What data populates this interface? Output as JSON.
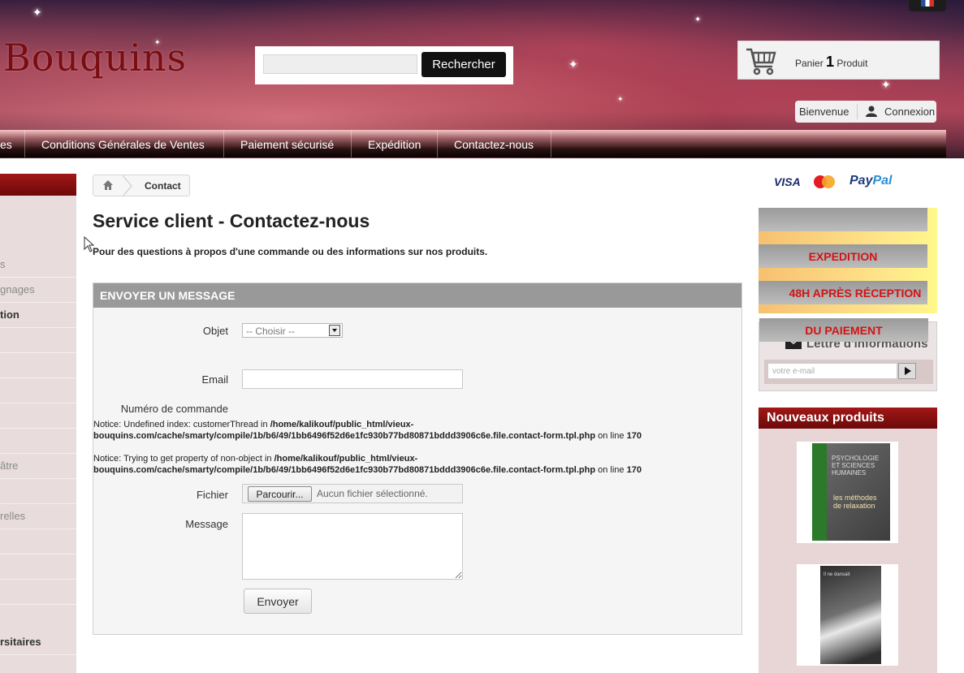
{
  "header": {
    "logo_text": "Bouquins",
    "search": {
      "placeholder": "",
      "button_label": "Rechercher"
    },
    "cart": {
      "label": "Panier",
      "count": "1",
      "unit": "Produit"
    },
    "user": {
      "welcome": "Bienvenue",
      "login": "Connexion"
    },
    "language_flag": "fr-flag-icon"
  },
  "nav": {
    "items": [
      "es",
      "Conditions Générales de Ventes",
      "Paiement sécurisé",
      "Expédition",
      "Contactez-nous"
    ]
  },
  "left_column": {
    "items": [
      "s",
      "gnages",
      "tion",
      "",
      "",
      "",
      "",
      "",
      "âtre",
      "",
      "relles",
      "",
      "",
      "",
      "rsitaires",
      ""
    ]
  },
  "breadcrumb": {
    "home_icon": "home-icon",
    "current": "Contact"
  },
  "main": {
    "title": "Service client - Contactez-nous",
    "intro": "Pour des questions à propos d'une commande ou des informations sur nos produits.",
    "form": {
      "header": "ENVOYER UN MESSAGE",
      "subject_label": "Objet",
      "subject_value": "-- Choisir --",
      "email_label": "Email",
      "email_value": "",
      "order_label": "Numéro de commande",
      "notice1": {
        "label": "Notice",
        "text": ": Undefined index: customerThread in ",
        "path": "/home/kalikouf/public_html/vieux-bouquins.com/cache/smarty/compile/1b/b6/49/1bb6496f52d6e1fc930b77bd80871bddd3906c6e.file.contact-form.tpl.php",
        "online": " on line ",
        "line": "170"
      },
      "notice2": {
        "label": "Notice",
        "text": ": Trying to get property of non-object in ",
        "path": "/home/kalikouf/public_html/vieux-bouquins.com/cache/smarty/compile/1b/b6/49/1bb6496f52d6e1fc930b77bd80871bddd3906c6e.file.contact-form.tpl.php",
        "online": " on line ",
        "line": "170"
      },
      "file_label": "Fichier",
      "browse_label": "Parcourir...",
      "file_status": "Aucun fichier sélectionné.",
      "message_label": "Message",
      "message_value": "",
      "send_label": "Envoyer"
    }
  },
  "right_column": {
    "payment": {
      "visa": "VISA",
      "mastercard": "MasterCard",
      "paypal_a": "Pay",
      "paypal_b": "Pal"
    },
    "promo": [
      "",
      "EXPEDITION",
      "48H APRÈS RÉCEPTION",
      "DU PAIEMENT"
    ],
    "newsletter": {
      "title": "Lettre d'informations",
      "placeholder": "votre e-mail"
    },
    "new_products": {
      "title": "Nouveaux produits",
      "book1": {
        "title": "PSYCHOLOGIE ET SCIENCES HUMAINES",
        "subtitle": "les méthodes de relaxation"
      },
      "book2": {
        "title": "Il ne dansait"
      }
    }
  },
  "colors": {
    "accent_red": "#8b0f0f",
    "nav_dark": "#1a0606",
    "promo_red": "#d21414"
  }
}
